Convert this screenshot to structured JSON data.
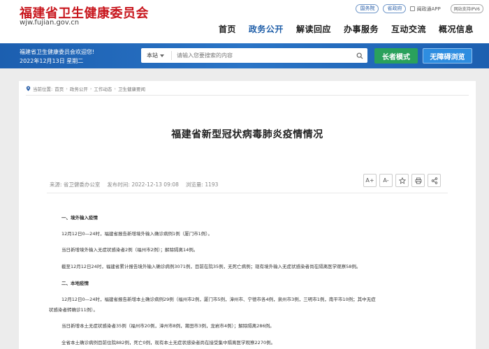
{
  "header": {
    "logo_title": "福建省卫生健康委员会",
    "logo_url": "wjw.fujian.gov.cn",
    "links": [
      "国务院",
      "省政府"
    ],
    "app_link": "闽政通APP",
    "ipv6": "网站支持IPV6",
    "nav": [
      "首页",
      "政务公开",
      "解读回应",
      "办事服务",
      "互动交流",
      "概况信息"
    ],
    "active_nav": "政务公开"
  },
  "bluebar": {
    "welcome": "福建省卫生健康委员会欢迎您!",
    "date": "2022年12月13日 星期二",
    "scope": "本站",
    "search_placeholder": "请输入您要搜索的内容",
    "elder_button": "长者模式",
    "access_button": "无障碍浏览"
  },
  "breadcrumb": {
    "prefix": "当前位置:",
    "items": [
      "首页",
      "政务公开",
      "工作动态",
      "卫生健康要闻"
    ]
  },
  "article": {
    "title": "福建省新型冠状病毒肺炎疫情情况",
    "source": "来源: 省卫健委办公室",
    "published": "发布时间: 2022-12-13 09:08",
    "views": "浏览量: 1193",
    "paragraphs": [
      "一、境外输入疫情",
      "12月12日0—24时，福建省报告新增境外输入确诊病例1例（厦门市1例）。",
      "当日新增境外输入无症状感染者2例（福州市2例）；解除隔离14例。",
      "截至12月12日24时，福建省累计报告境外输入确诊病例3071例，目前在院35例，无死亡病例；现有境外输入无症状感染者尚在隔离医学观察58例。",
      "二、本地疫情",
      "12月12日0—24时，福建省报告新增本土确诊病例29例（福州市2例，厦门市5例，漳州市、宁德市各4例，泉州市3例，三明市1例，南平市10例；其中无症",
      "状感染者转确诊11例）。",
      "当日新增本土无症状感染者35例（福州市20例，漳州市8例，莆田市3例，龙岩市4例）；解除隔离286例。",
      "全省本土确诊病例目前住院882例，死亡0例，现有本土无症状感染者尚在接受集中隔离医学观察2270例。"
    ]
  },
  "tools": [
    "A+",
    "A-",
    "star-icon",
    "print-icon",
    "share-icon"
  ],
  "colors": {
    "brand_red": "#c8161d",
    "brand_blue": "#1f5ea8",
    "elder_green": "#2aa15c",
    "access_blue": "#2e8de0"
  }
}
